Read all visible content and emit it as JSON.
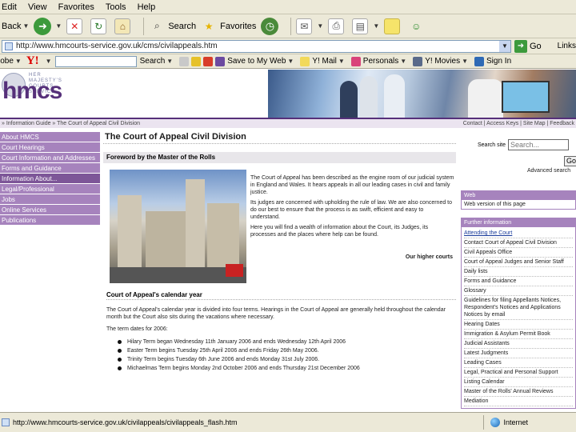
{
  "menu": [
    "Edit",
    "View",
    "Favorites",
    "Tools",
    "Help"
  ],
  "toolbar": {
    "back": "Back",
    "search": "Search",
    "favorites": "Favorites"
  },
  "address": {
    "url": "http://www.hmcourts-service.gov.uk/cms/civilappeals.htm",
    "go": "Go",
    "links": "Links"
  },
  "yahoo": {
    "brand": "Y!",
    "adobe": "Adobe",
    "search": "Search",
    "save": "Save to My Web",
    "mail": "Y! Mail",
    "personals": "Personals",
    "movies": "Y! Movies",
    "signin": "Sign In"
  },
  "site": {
    "crest_text": "HER MAJESTY'S COURTS SERVICE",
    "logo": "hmcs",
    "breadcrumb": "» Information Guide » The Court of Appeal Civil Division",
    "utility": "Contact | Access Keys | Site Map | Feedback"
  },
  "nav": [
    "About HMCS",
    "Court Hearings",
    "Court Information and Addresses",
    "Forms and Guidance",
    "Information About...",
    "Legal/Professional",
    "Jobs",
    "Online Services",
    "Publications"
  ],
  "content": {
    "heading": "The Court of Appeal Civil Division",
    "foreword_header": "Foreword by the Master of the Rolls",
    "intro": [
      "The Court of Appeal has been described as the engine room of our judicial system in England and Wales. It hears appeals in all our leading cases in civil and family justice.",
      "Its judges are concerned with upholding the rule of law. We are also concerned to do our best to ensure that the process is as swift, efficient and easy to understand.",
      "Here you will find a wealth of information about the Court, its Judges, its processes and the places where help can be found."
    ],
    "intro_link": "Our higher courts",
    "calendar_header": "Court of Appeal's calendar year",
    "calendar_text": "The Court of Appeal's calendar year is divided into four terms. Hearings in the Court of Appeal are generally held throughout the calendar month but the Court also sits during the vacations where necessary.",
    "term_intro": "The term dates for 2006:",
    "terms": [
      "Hilary Term began Wednesday 11th January 2006 and ends Wednesday 12th April 2006",
      "Easter Term begins Tuesday 25th April 2006 and ends Friday 26th May 2006.",
      "Trinity Term begins Tuesday 6th June 2006 and ends Monday 31st July 2006.",
      "Michaelmas Term begins Monday 2nd October 2006 and ends Thursday 21st December 2006"
    ]
  },
  "sidebar": {
    "search_label": "Search site",
    "search_placeholder": "Search...",
    "go": "Go",
    "advanced": "Advanced search",
    "web_title": "Web",
    "web_item": "Web version of this page",
    "info_title": "Further information",
    "links": [
      "Attending the Court",
      "Contact Court of Appeal Civil Division",
      "Civil Appeals Office",
      "Court of Appeal Judges and Senior Staff",
      "Daily lists",
      "Forms and Guidance",
      "Glossary",
      "Guidelines for filing Appellants Notices, Respondent's Notices and Applications Notices by email",
      "Hearing Dates",
      "Immigration & Asylum Permit Book",
      "Judicial Assistants",
      "Latest Judgments",
      "Leading Cases",
      "Legal, Practical and Personal Support",
      "Listing Calendar",
      "Master of the Rolls' Annual Reviews",
      "Mediation"
    ]
  },
  "status": {
    "url": "http://www.hmcourts-service.gov.uk/civilappeals/civilappeals_flash.htm",
    "zone": "Internet"
  }
}
